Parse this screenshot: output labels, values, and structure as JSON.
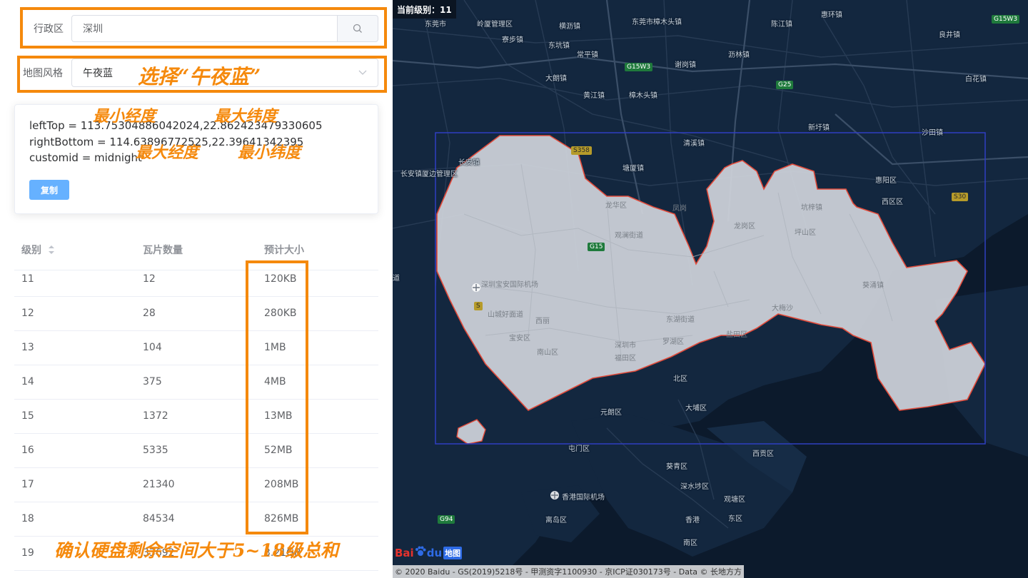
{
  "form": {
    "region_label": "行政区",
    "region_value": "深圳",
    "style_label": "地图风格",
    "style_value": "午夜蓝"
  },
  "info": {
    "left_top": "leftTop = 113.75304886042024,22.862423479330605",
    "right_bottom": "rightBottom = 114.63896772525,22.39641342395",
    "custom_id": "customid = midnight",
    "copy_label": "复制"
  },
  "annotations": {
    "select_midnight": "选择“午夜蓝”",
    "min_lng": "最小经度",
    "max_lat": "最大纬度",
    "max_lng": "最大经度",
    "min_lat": "最小纬度",
    "disk_note": "确认硬盘剩余空间大于5~18级总和"
  },
  "table": {
    "headers": [
      "级别",
      "瓦片数量",
      "预计大小"
    ],
    "rows": [
      {
        "level": "11",
        "count": "12",
        "size": "120KB"
      },
      {
        "level": "12",
        "count": "28",
        "size": "280KB"
      },
      {
        "level": "13",
        "count": "104",
        "size": "1MB"
      },
      {
        "level": "14",
        "count": "375",
        "size": "4MB"
      },
      {
        "level": "15",
        "count": "1372",
        "size": "13MB"
      },
      {
        "level": "16",
        "count": "5335",
        "size": "52MB"
      },
      {
        "level": "17",
        "count": "21340",
        "size": "208MB"
      },
      {
        "level": "18",
        "count": "84534",
        "size": "826MB"
      },
      {
        "level": "19",
        "count": "33692",
        "size": "3.21GB"
      }
    ]
  },
  "map": {
    "zoom_text": "当前级别：11",
    "logo_text": "Bai",
    "logo_text2": "du",
    "logo_map": "地图",
    "copyright": "© 2020 Baidu - GS(2019)5218号 - 甲测资字1100930 - 京ICP证030173号 - Data © 长地方方",
    "labels": [
      {
        "name": "label-dongguan",
        "text": "东莞市"
      },
      {
        "name": "label-lingtou",
        "text": "岭厦管理区"
      },
      {
        "name": "label-hengli",
        "text": "横沥镇"
      },
      {
        "name": "label-zhangmutou",
        "text": "东莞市樟木头镇"
      },
      {
        "name": "label-huihuan",
        "text": "惠环镇"
      },
      {
        "name": "label-chenjiang",
        "text": "陈江镇"
      },
      {
        "name": "label-liangjing",
        "text": "良井镇"
      },
      {
        "name": "label-liaobu",
        "text": "寮步镇"
      },
      {
        "name": "label-dongkeng",
        "text": "东坑镇"
      },
      {
        "name": "label-changping",
        "text": "常平镇"
      },
      {
        "name": "label-lilin",
        "text": "沥林镇"
      },
      {
        "name": "label-dalang",
        "text": "大朗镇"
      },
      {
        "name": "label-xiegang",
        "text": "谢岗镇"
      },
      {
        "name": "label-huangjiang",
        "text": "黄江镇"
      },
      {
        "name": "label-zhangmutou2",
        "text": "樟木头镇"
      },
      {
        "name": "label-baihua",
        "text": "白花镇"
      },
      {
        "name": "label-xinxu",
        "text": "新圩镇"
      },
      {
        "name": "label-shatian",
        "text": "沙田镇"
      },
      {
        "name": "label-qingxi",
        "text": "清溪镇"
      },
      {
        "name": "label-changan",
        "text": "长安镇"
      },
      {
        "name": "label-tangxia",
        "text": "塘厦镇"
      },
      {
        "name": "label-huiyang",
        "text": "惠阳区"
      },
      {
        "name": "label-xiqu",
        "text": "西区区"
      },
      {
        "name": "label-changangl",
        "text": "长安镇厦边管理区"
      },
      {
        "name": "label-longhua",
        "text": "龙华区"
      },
      {
        "name": "label-fenggang",
        "text": "凤岗"
      },
      {
        "name": "label-longgang",
        "text": "龙岗区"
      },
      {
        "name": "label-kengzi",
        "text": "坑梓镇"
      },
      {
        "name": "label-guanlan",
        "text": "观澜街道"
      },
      {
        "name": "label-pingshan",
        "text": "坪山区"
      },
      {
        "name": "label-baoan-airport",
        "text": "深圳宝安国际机场"
      },
      {
        "name": "label-kuichong",
        "text": "葵涌镇"
      },
      {
        "name": "label-guangming",
        "text": "山城好面道"
      },
      {
        "name": "label-xili",
        "text": "西丽"
      },
      {
        "name": "label-dameisha",
        "text": "大梅沙"
      },
      {
        "name": "label-baoan",
        "text": "宝安区"
      },
      {
        "name": "label-nanshan",
        "text": "南山区"
      },
      {
        "name": "label-shenzhen",
        "text": "深圳市"
      },
      {
        "name": "label-futian",
        "text": "福田区"
      },
      {
        "name": "label-luohu",
        "text": "罗湖区"
      },
      {
        "name": "label-yantian",
        "text": "盐田区"
      },
      {
        "name": "label-dapeng",
        "text": "东湖街道"
      },
      {
        "name": "label-beiqu",
        "text": "北区"
      },
      {
        "name": "label-yuanlang",
        "text": "元朗区"
      },
      {
        "name": "label-dapu",
        "text": "大埔区"
      },
      {
        "name": "label-tunmen",
        "text": "屯门区"
      },
      {
        "name": "label-xigong",
        "text": "西贡区"
      },
      {
        "name": "label-kuiqing",
        "text": "葵青区"
      },
      {
        "name": "label-shashuipo",
        "text": "深水埗区"
      },
      {
        "name": "label-hk-airport",
        "text": "香港国际机场"
      },
      {
        "name": "label-guantang",
        "text": "观塘区"
      },
      {
        "name": "label-lidao",
        "text": "离岛区"
      },
      {
        "name": "label-hongkong",
        "text": "香港"
      },
      {
        "name": "label-dongqu",
        "text": "东区"
      },
      {
        "name": "label-nanqu",
        "text": "南区"
      },
      {
        "name": "label-dao",
        "text": "道"
      }
    ],
    "roads": [
      {
        "name": "badge-g15w3-top",
        "text": "G15W3"
      },
      {
        "name": "badge-g15w3",
        "text": "G15W3"
      },
      {
        "name": "badge-g25",
        "text": "G25"
      },
      {
        "name": "badge-s358",
        "text": "S358"
      },
      {
        "name": "badge-g15",
        "text": "G15"
      },
      {
        "name": "badge-s30",
        "text": "S30"
      },
      {
        "name": "badge-g94",
        "text": "G94"
      },
      {
        "name": "badge-s",
        "text": "S"
      }
    ]
  }
}
